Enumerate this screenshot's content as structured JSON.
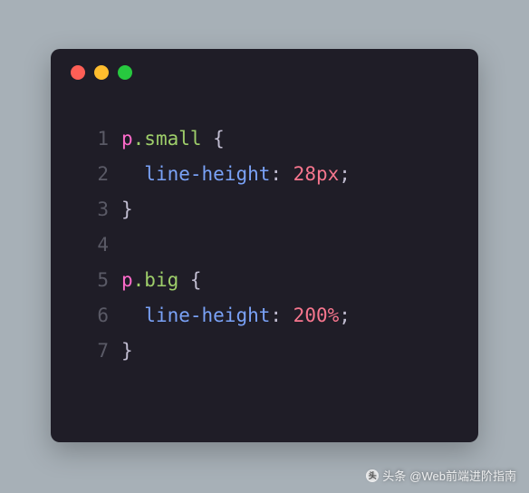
{
  "code": {
    "lines": [
      {
        "num": "1",
        "tokens": [
          {
            "t": "p",
            "c": "tok-tag"
          },
          {
            "t": ".small",
            "c": "tok-class"
          },
          {
            "t": " ",
            "c": "tok-plain"
          },
          {
            "t": "{",
            "c": "tok-punct"
          }
        ]
      },
      {
        "num": "2",
        "tokens": [
          {
            "t": "  ",
            "c": "tok-plain"
          },
          {
            "t": "line-height",
            "c": "tok-prop"
          },
          {
            "t": ": ",
            "c": "tok-punct"
          },
          {
            "t": "28px",
            "c": "tok-num"
          },
          {
            "t": ";",
            "c": "tok-punct"
          }
        ]
      },
      {
        "num": "3",
        "tokens": [
          {
            "t": "}",
            "c": "tok-punct"
          }
        ]
      },
      {
        "num": "4",
        "tokens": []
      },
      {
        "num": "5",
        "tokens": [
          {
            "t": "p",
            "c": "tok-tag"
          },
          {
            "t": ".big",
            "c": "tok-class"
          },
          {
            "t": " ",
            "c": "tok-plain"
          },
          {
            "t": "{",
            "c": "tok-punct"
          }
        ]
      },
      {
        "num": "6",
        "tokens": [
          {
            "t": "  ",
            "c": "tok-plain"
          },
          {
            "t": "line-height",
            "c": "tok-prop"
          },
          {
            "t": ": ",
            "c": "tok-punct"
          },
          {
            "t": "200%",
            "c": "tok-num"
          },
          {
            "t": ";",
            "c": "tok-punct"
          }
        ]
      },
      {
        "num": "7",
        "tokens": [
          {
            "t": "}",
            "c": "tok-punct"
          }
        ]
      }
    ]
  },
  "watermark": {
    "prefix": "头条",
    "text": "@Web前端进阶指南"
  }
}
